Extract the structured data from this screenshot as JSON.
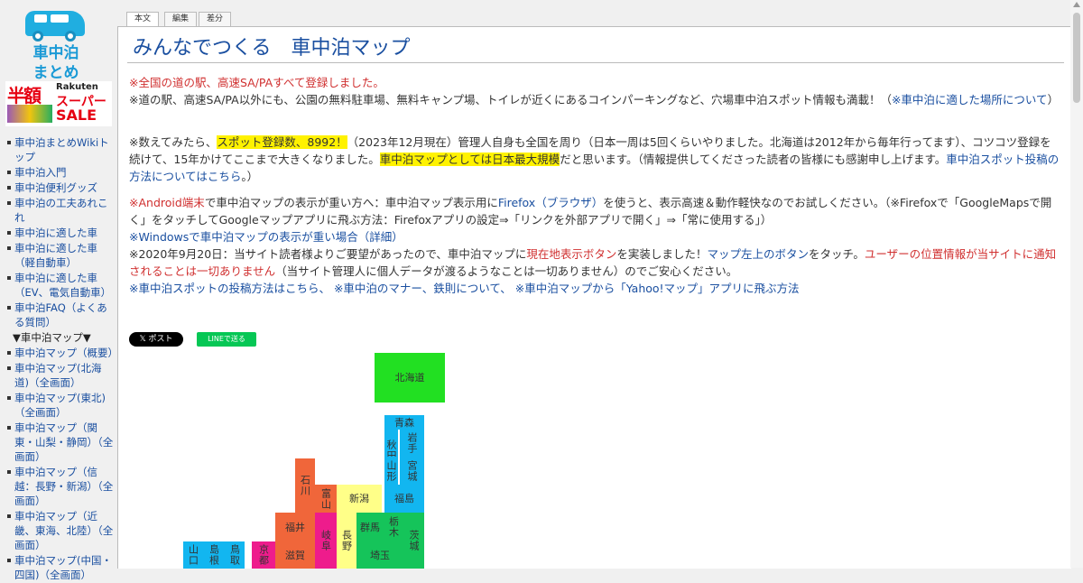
{
  "logo": {
    "line1": "車中泊",
    "line2": "まとめ"
  },
  "banner": {
    "big": "半額",
    "brand": "Rakuten",
    "line1": "スーパー",
    "line2": "SALE"
  },
  "sidebar": {
    "items": [
      {
        "type": "link",
        "label": "車中泊まとめWikiトップ"
      },
      {
        "type": "link",
        "label": "車中泊入門"
      },
      {
        "type": "link",
        "label": "車中泊便利グッズ"
      },
      {
        "type": "link",
        "label": "車中泊の工夫あれこれ"
      },
      {
        "type": "link",
        "label": "車中泊に適した車"
      },
      {
        "type": "link",
        "label": "車中泊に適した車（軽自動車）"
      },
      {
        "type": "link",
        "label": "車中泊に適した車（EV、電気自動車）"
      },
      {
        "type": "link",
        "label": "車中泊FAQ（よくある質問）"
      },
      {
        "type": "head",
        "label": "▼車中泊マップ▼"
      },
      {
        "type": "link",
        "label": "車中泊マップ（概要）"
      },
      {
        "type": "link",
        "label": "車中泊マップ(北海道)（全画面）"
      },
      {
        "type": "link",
        "label": "車中泊マップ(東北)（全画面）"
      },
      {
        "type": "link",
        "label": "車中泊マップ（関東・山梨・静岡）（全画面）"
      },
      {
        "type": "link",
        "label": "車中泊マップ（信越：長野・新潟）（全画面）"
      },
      {
        "type": "link",
        "label": "車中泊マップ（近畿、東海、北陸）（全画面）"
      },
      {
        "type": "link",
        "label": "車中泊マップ(中国・四国)（全画面）"
      }
    ]
  },
  "tabs": [
    "本文",
    "編集",
    "差分"
  ],
  "page": {
    "title": "みんなでつくる　車中泊マップ"
  },
  "paragraphs": {
    "p1_red": "※全国の道の駅、高速SA/PAすべて登録しました。",
    "p1_text": "※道の駅、高速SA/PA以外にも、公園の無料駐車場、無料キャンプ場、トイレが近くにあるコインパーキングなど、穴場車中泊スポット情報も満載！（",
    "p1_link": "※車中泊に適した場所について",
    "p1_end": "）",
    "p2_a": "※数えてみたら、",
    "p2_hl1": "スポット登録数、8992！",
    "p2_b": "（2023年12月現在）管理人自身も全国を周り（日本一周は5回くらいやりました。北海道は2012年から毎年行ってます）、コツコツ登録を続けて、15年かけてここまで大きくなりました。",
    "p2_hl2": "車中泊マップとしては日本最大規模",
    "p2_c": "だと思います。（情報提供してくださった読者の皆様にも感謝申し上げます。",
    "p2_link": "車中泊スポット投稿の方法についてはこちら",
    "p2_d": "。）",
    "p3_a": "※",
    "p3_android": "Android端末",
    "p3_b": "で車中泊マップの表示が重い方へ：車中泊マップ表示用に",
    "p3_firefox": "Firefox（ブラウザ）",
    "p3_c": "を使うと、表示高速＆動作軽快なのでお試しください。（※Firefoxで「GoogleMapsで開く」をタッチしてGoogleマップアプリに飛ぶ方法：Firefoxアプリの設定⇒「リンクを外部アプリで開く」⇒「常に使用する」）",
    "p3_win": "※Windowsで車中泊マップの表示が重い場合（詳細）",
    "p3_d": "※2020年9月20日：当サイト読者様よりご要望があったので、車中泊マップに",
    "p3_btn": "現在地表示ボタン",
    "p3_e": "を実装しました！",
    "p3_btn2": "マップ左上のボタン",
    "p3_f": "をタッチ。",
    "p3_privacy": "ユーザーの位置情報が当サイトに通知されることは一切ありません",
    "p3_g": "（当サイト管理人に個人データが渡るようなことは一切ありません）のでご安心ください。",
    "p3_links": "※車中泊スポットの投稿方法はこちら、 ※車中泊のマナー、鉄則について、 ※車中泊マップから「Yahoo!マップ」アプリに飛ぶ方法"
  },
  "sns": {
    "x": "𝕏 ポスト",
    "line": "LINEで送る"
  },
  "map": {
    "prefectures": [
      {
        "name": "北海道",
        "color": "#22e022"
      },
      {
        "name": "青森",
        "color": "#12b6f0"
      },
      {
        "name": "秋田",
        "color": "#12b6f0"
      },
      {
        "name": "岩手",
        "color": "#12b6f0"
      },
      {
        "name": "山形",
        "color": "#12b6f0"
      },
      {
        "name": "宮城",
        "color": "#12b6f0"
      },
      {
        "name": "福島",
        "color": "#12b6f0"
      },
      {
        "name": "石川",
        "color": "#f0663a"
      },
      {
        "name": "富山",
        "color": "#f0663a"
      },
      {
        "name": "新潟",
        "color": "#ffff88"
      },
      {
        "name": "福井",
        "color": "#f0663a"
      },
      {
        "name": "長野",
        "color": "#ffff88"
      },
      {
        "name": "岐阜",
        "color": "#ee1c8c"
      },
      {
        "name": "群馬",
        "color": "#15c45a"
      },
      {
        "name": "栃木",
        "color": "#15c45a"
      },
      {
        "name": "茨城",
        "color": "#15c45a"
      },
      {
        "name": "滋賀",
        "color": "#f0663a"
      },
      {
        "name": "埼玉",
        "color": "#15c45a"
      },
      {
        "name": "京都",
        "color": "#ee1c8c"
      },
      {
        "name": "鳥取",
        "color": "#12b6f0"
      },
      {
        "name": "島根",
        "color": "#12b6f0"
      },
      {
        "name": "山口",
        "color": "#12b6f0"
      }
    ]
  }
}
